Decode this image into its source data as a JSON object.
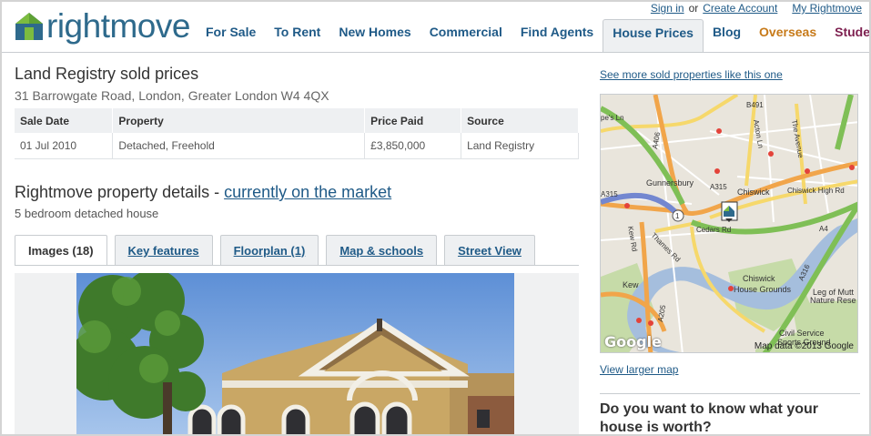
{
  "header": {
    "logo_text": "rightmove",
    "top_links": {
      "sign_in": "Sign in",
      "or": "or",
      "create_account": "Create Account",
      "my_rightmove": "My Rightmove"
    },
    "nav": [
      {
        "label": "For Sale"
      },
      {
        "label": "To Rent"
      },
      {
        "label": "New Homes"
      },
      {
        "label": "Commercial"
      },
      {
        "label": "Find Agents"
      },
      {
        "label": "House Prices"
      },
      {
        "label": "Blog"
      },
      {
        "label": "Overseas"
      },
      {
        "label": "Students"
      }
    ]
  },
  "sold": {
    "title": "Land Registry sold prices",
    "address": "31 Barrowgate Road, London, Greater London W4 4QX",
    "columns": [
      "Sale Date",
      "Property",
      "Price Paid",
      "Source"
    ],
    "rows": [
      [
        "01 Jul 2010",
        "Detached, Freehold",
        "£3,850,000",
        "Land Registry"
      ]
    ]
  },
  "details": {
    "title_prefix": "Rightmove property details - ",
    "title_link": "currently on the market",
    "subtitle": "5 bedroom detached house",
    "tabs": [
      "Images (18)",
      "Key features",
      "Floorplan (1)",
      "Map & schools",
      "Street View"
    ]
  },
  "sidebar": {
    "see_more": "See more sold properties like this one",
    "map": {
      "labels": {
        "gunnersbury": "Gunnersbury",
        "chiswick": "Chiswick",
        "chiswick_high_rd": "Chiswick High Rd",
        "cedars_rd": "Cedars Rd",
        "kew_rd": "Kew Rd",
        "thames_rd": "Thames Rd",
        "chiswick_house_grounds_1": "Chiswick",
        "chiswick_house_grounds_2": "House Grounds",
        "kew": "Kew",
        "leg_of_mutton_1": "Leg of Mutt",
        "leg_of_mutton_2": "Nature Rese",
        "civil_service_1": "Civil Service",
        "civil_service_2": "Sports Ground",
        "acton_ln": "Acton Ln",
        "the_avenue": "The Avenue",
        "pes_ln": "pe's Ln",
        "a315_1": "A315",
        "a315_2": "A315",
        "a406": "A406",
        "a205": "A205",
        "a316": "A316",
        "a4": "A4",
        "b491": "B491",
        "route_1": "1"
      },
      "google": "Google",
      "attribution": "Map data ©2013 Google"
    },
    "view_larger": "View larger map",
    "worth_heading": "Do you want to know what your house is worth?"
  }
}
